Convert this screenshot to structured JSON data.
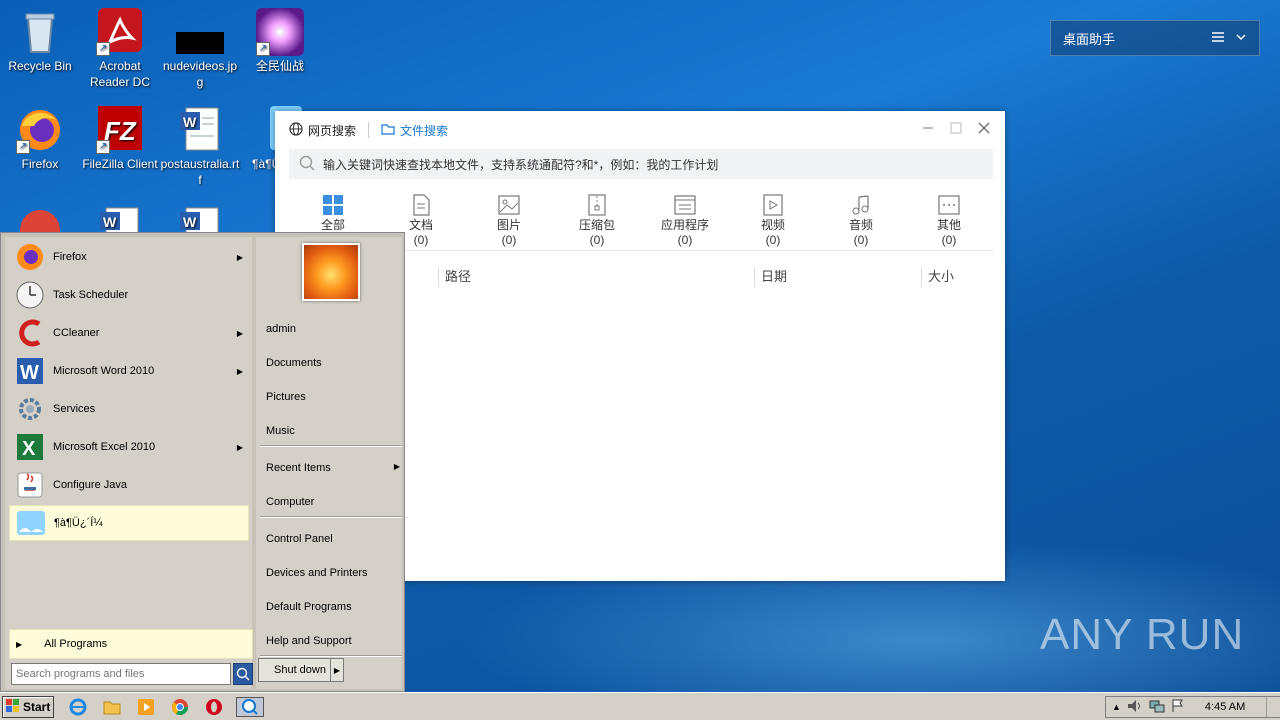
{
  "desktop": {
    "icons": [
      {
        "label": "Recycle Bin"
      },
      {
        "label": "Acrobat Reader DC"
      },
      {
        "label": "nudevideos.jpg"
      },
      {
        "label": "全民仙战"
      },
      {
        "label": "Firefox"
      },
      {
        "label": "FileZilla Client"
      },
      {
        "label": "postaustralia.rtf"
      },
      {
        "label": "¶à¶Ü"
      }
    ]
  },
  "widget": {
    "title": "桌面助手"
  },
  "search_window": {
    "tabs": [
      {
        "label": "网页搜索"
      },
      {
        "label": "文件搜索"
      }
    ],
    "search_placeholder": "输入关键词快速查找本地文件，支持系统通配符?和*，例如：我的工作计划",
    "categories": [
      {
        "label": "全部",
        "count": ""
      },
      {
        "label": "文档",
        "count": "(0)"
      },
      {
        "label": "图片",
        "count": "(0)"
      },
      {
        "label": "压缩包",
        "count": "(0)"
      },
      {
        "label": "应用程序",
        "count": "(0)"
      },
      {
        "label": "视频",
        "count": "(0)"
      },
      {
        "label": "音频",
        "count": "(0)"
      },
      {
        "label": "其他",
        "count": "(0)"
      }
    ],
    "columns": [
      {
        "label": "路径"
      },
      {
        "label": "日期"
      },
      {
        "label": "大小"
      }
    ]
  },
  "start_menu": {
    "programs": [
      {
        "label": "Firefox",
        "has_arrow": true
      },
      {
        "label": "Task Scheduler",
        "has_arrow": false
      },
      {
        "label": "CCleaner",
        "has_arrow": true
      },
      {
        "label": "Microsoft Word 2010",
        "has_arrow": true
      },
      {
        "label": "Services",
        "has_arrow": false
      },
      {
        "label": "Microsoft Excel 2010",
        "has_arrow": true
      },
      {
        "label": "Configure Java",
        "has_arrow": false
      },
      {
        "label": "¶à¶Ü¿´Í¼",
        "has_arrow": false
      }
    ],
    "all_programs": "All Programs",
    "search_placeholder": "Search programs and files",
    "right_links": [
      {
        "label": "admin"
      },
      {
        "label": "Documents"
      },
      {
        "label": "Pictures"
      },
      {
        "label": "Music"
      },
      {
        "label": "Recent Items"
      },
      {
        "label": "Computer"
      },
      {
        "label": "Control Panel"
      },
      {
        "label": "Devices and Printers"
      },
      {
        "label": "Default Programs"
      },
      {
        "label": "Help and Support"
      }
    ],
    "shutdown_label": "Shut down"
  },
  "taskbar": {
    "start_label": "Start",
    "clock": "4:45 AM"
  },
  "watermark": {
    "text": "ANY RUN"
  }
}
